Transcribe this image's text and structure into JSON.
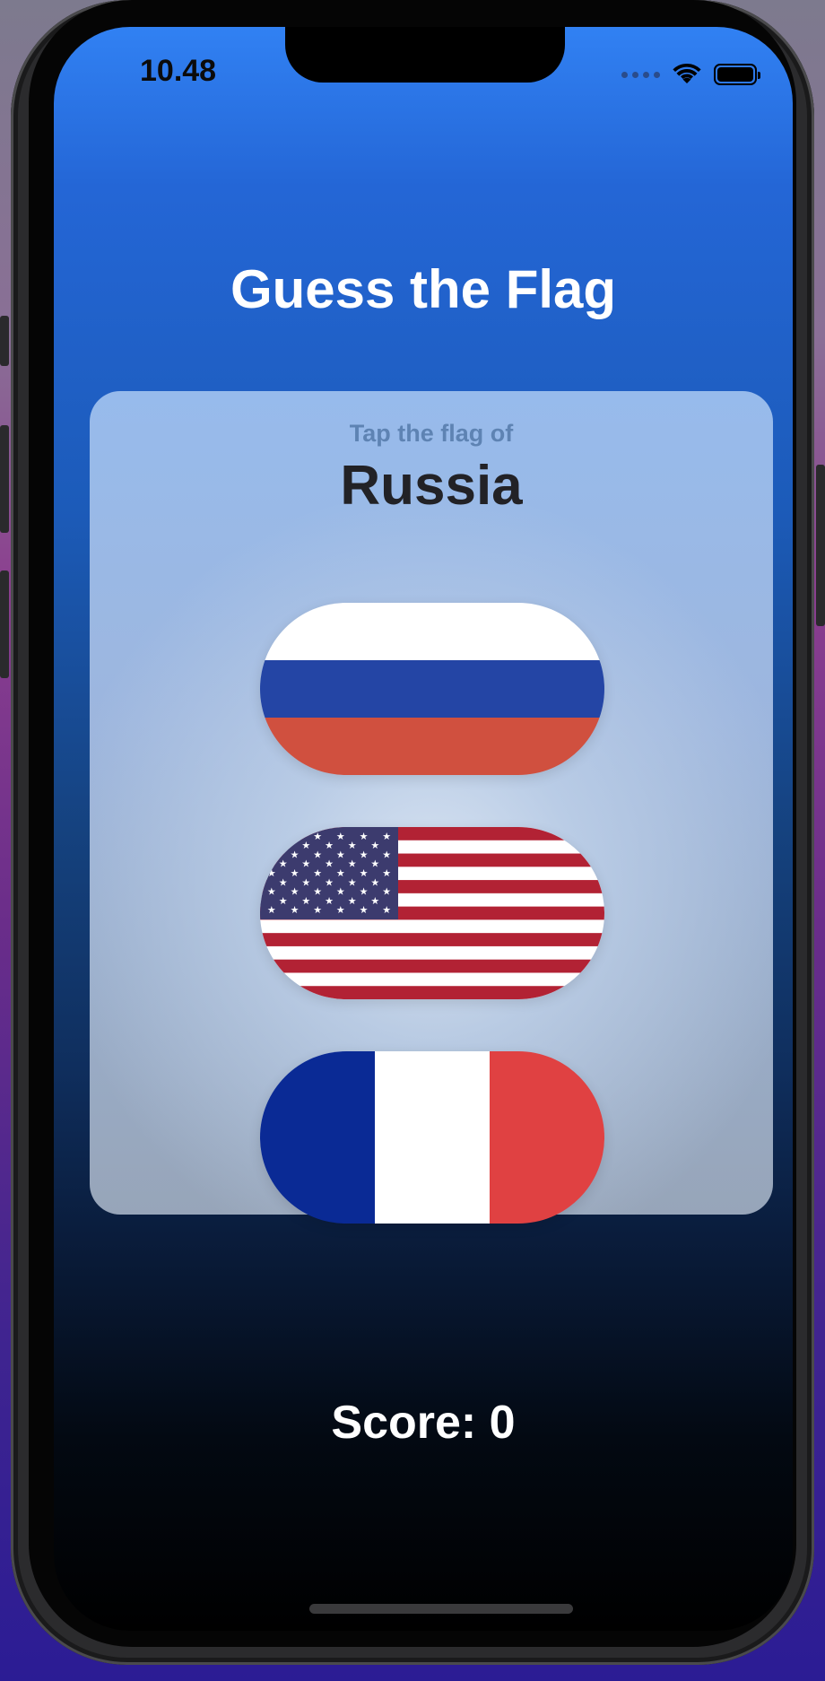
{
  "status_bar": {
    "time": "10.48"
  },
  "app": {
    "title": "Guess the Flag",
    "prompt_label": "Tap the flag of",
    "target_country": "Russia",
    "score_text": "Score: 0"
  },
  "flags": [
    {
      "country": "Russia",
      "icon": "russia-flag"
    },
    {
      "country": "United States",
      "icon": "usa-flag"
    },
    {
      "country": "France",
      "icon": "france-flag"
    }
  ],
  "colors": {
    "background_top": "#3181f3",
    "background_bottom": "#000000",
    "card": "#9db6de",
    "prompt_label": "#5e83b3",
    "title": "#ffffff"
  }
}
